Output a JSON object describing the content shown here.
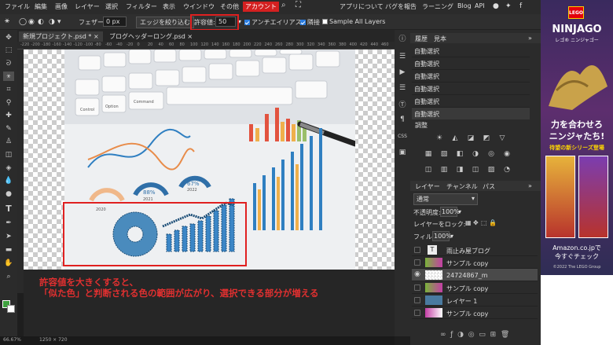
{
  "menu": {
    "items": [
      "ファイル",
      "編集",
      "画像",
      "レイヤー",
      "選択",
      "フィルター",
      "表示",
      "ウインドウ",
      "その他",
      "アカウント"
    ],
    "right_items": [
      "アプリについて",
      "バグを報告",
      "ラーニング",
      "Blog",
      "API"
    ]
  },
  "options": {
    "feather_label": "フェザー:",
    "feather_value": "0 px",
    "refine_edge": "エッジを絞り込む",
    "tolerance_label": "許容値:",
    "tolerance_value": "50",
    "antialias": "アンチエイリアス",
    "contiguous": "隣接",
    "sample_all": "Sample All Layers"
  },
  "tabs": [
    {
      "label": "新規プロジェクト.psd *"
    },
    {
      "label": "ブログヘッダーロング.psd"
    }
  ],
  "ruler_ticks": [
    "-220",
    "-200",
    "-180",
    "-160",
    "-140",
    "-120",
    "-100",
    "-80",
    "-60",
    "-40",
    "-20",
    "0",
    "20",
    "40",
    "60",
    "80",
    "100",
    "120",
    "140",
    "160",
    "180",
    "200",
    "220",
    "240",
    "260",
    "280",
    "300",
    "320",
    "340",
    "360",
    "380",
    "400",
    "420",
    "440",
    "460"
  ],
  "photo": {
    "keys": [
      "Control",
      "Option",
      "Command"
    ],
    "gauges": [
      "88%",
      "67%"
    ],
    "years": [
      "2020",
      "2021",
      "2022"
    ]
  },
  "caption": {
    "line1": "許容値を大きくすると、",
    "line2": "「似た色」と判断される色の範囲が広がり、選択できる部分が増える"
  },
  "status": {
    "zoom": "66.67%",
    "size": "1250 × 720"
  },
  "history_panel": {
    "tabs": [
      "履歴",
      "見本"
    ],
    "items": [
      "自動選択",
      "自動選択",
      "自動選択",
      "自動選択",
      "自動選択",
      "自動選択"
    ]
  },
  "adjustments": {
    "title": "調整"
  },
  "layers_panel": {
    "tabs": [
      "レイヤー",
      "チャンネル",
      "パス"
    ],
    "blend_mode": "通常",
    "opacity_label": "不透明度:",
    "opacity_value": "100%",
    "lock_label": "レイヤーをロック:",
    "fill_label": "フィル:",
    "fill_value": "100%",
    "layers": [
      {
        "name": "雨止み屋ブログ",
        "type": "text",
        "visible": false,
        "selected": false
      },
      {
        "name": "サンプル copy",
        "type": "image",
        "visible": false,
        "selected": false
      },
      {
        "name": "24724867_m",
        "type": "photo",
        "visible": true,
        "selected": true
      },
      {
        "name": "サンプル copy",
        "type": "image",
        "visible": false,
        "selected": false
      },
      {
        "name": "レイヤー 1",
        "type": "fill",
        "visible": false,
        "selected": false
      },
      {
        "name": "サンプル copy",
        "type": "image",
        "visible": false,
        "selected": false
      }
    ]
  },
  "ad": {
    "brand": "LEGO",
    "title": "NINJAGO",
    "subtitle": "レゴ® ニンジャゴー",
    "headline1": "力を合わせろ",
    "headline2": "ニンジャたち!",
    "tagline": "待望の新シリーズ登場",
    "site": "Amazon.co.jpで",
    "cta": "今すぐチェック",
    "copyright": "©2022 The LEGO Group"
  },
  "colors": {
    "accent_red": "#e02020",
    "menu_active": "#d42020",
    "panel_bg": "#2b2b2b",
    "fg_color": "#3ea13e",
    "bg_color": "#ffffff"
  }
}
